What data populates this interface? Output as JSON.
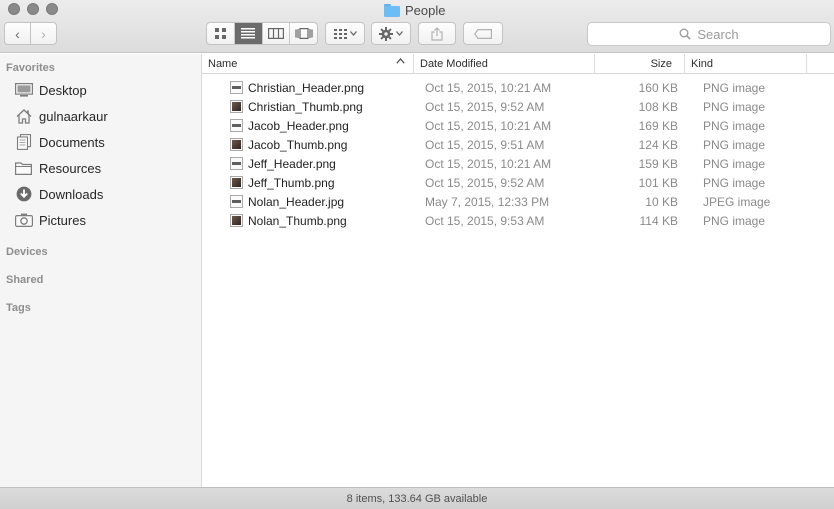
{
  "window": {
    "title": "People",
    "icons": {
      "folder": "folder-icon"
    }
  },
  "toolbar": {
    "back_icon": "‹",
    "forward_icon": "›",
    "view_modes": [
      "icon",
      "list",
      "column",
      "coverflow"
    ],
    "active_view": "list",
    "search_placeholder": "Search"
  },
  "sidebar": {
    "favorites_title": "Favorites",
    "favorites": [
      {
        "label": "Desktop",
        "icon": "desktop-icon"
      },
      {
        "label": "gulnaarkaur",
        "icon": "home-icon"
      },
      {
        "label": "Documents",
        "icon": "documents-icon"
      },
      {
        "label": "Resources",
        "icon": "folder-icon"
      },
      {
        "label": "Downloads",
        "icon": "downloads-icon"
      },
      {
        "label": "Pictures",
        "icon": "camera-icon"
      }
    ],
    "devices_title": "Devices",
    "shared_title": "Shared",
    "tags_title": "Tags"
  },
  "columns": {
    "name": "Name",
    "date": "Date Modified",
    "size": "Size",
    "kind": "Kind"
  },
  "files": [
    {
      "name": "Christian_Header.png",
      "date": "Oct 15, 2015, 10:21 AM",
      "size": "160 KB",
      "kind": "PNG image",
      "thumb": "strip"
    },
    {
      "name": "Christian_Thumb.png",
      "date": "Oct 15, 2015, 9:52 AM",
      "size": "108 KB",
      "kind": "PNG image",
      "thumb": "photo"
    },
    {
      "name": "Jacob_Header.png",
      "date": "Oct 15, 2015, 10:21 AM",
      "size": "169 KB",
      "kind": "PNG image",
      "thumb": "strip"
    },
    {
      "name": "Jacob_Thumb.png",
      "date": "Oct 15, 2015, 9:51 AM",
      "size": "124 KB",
      "kind": "PNG image",
      "thumb": "photo"
    },
    {
      "name": "Jeff_Header.png",
      "date": "Oct 15, 2015, 10:21 AM",
      "size": "159 KB",
      "kind": "PNG image",
      "thumb": "strip"
    },
    {
      "name": "Jeff_Thumb.png",
      "date": "Oct 15, 2015, 9:52 AM",
      "size": "101 KB",
      "kind": "PNG image",
      "thumb": "photo"
    },
    {
      "name": "Nolan_Header.jpg",
      "date": "May 7, 2015, 12:33 PM",
      "size": "10 KB",
      "kind": "JPEG image",
      "thumb": "strip"
    },
    {
      "name": "Nolan_Thumb.png",
      "date": "Oct 15, 2015, 9:53 AM",
      "size": "114 KB",
      "kind": "PNG image",
      "thumb": "photo"
    }
  ],
  "status": "8 items, 133.64 GB available"
}
